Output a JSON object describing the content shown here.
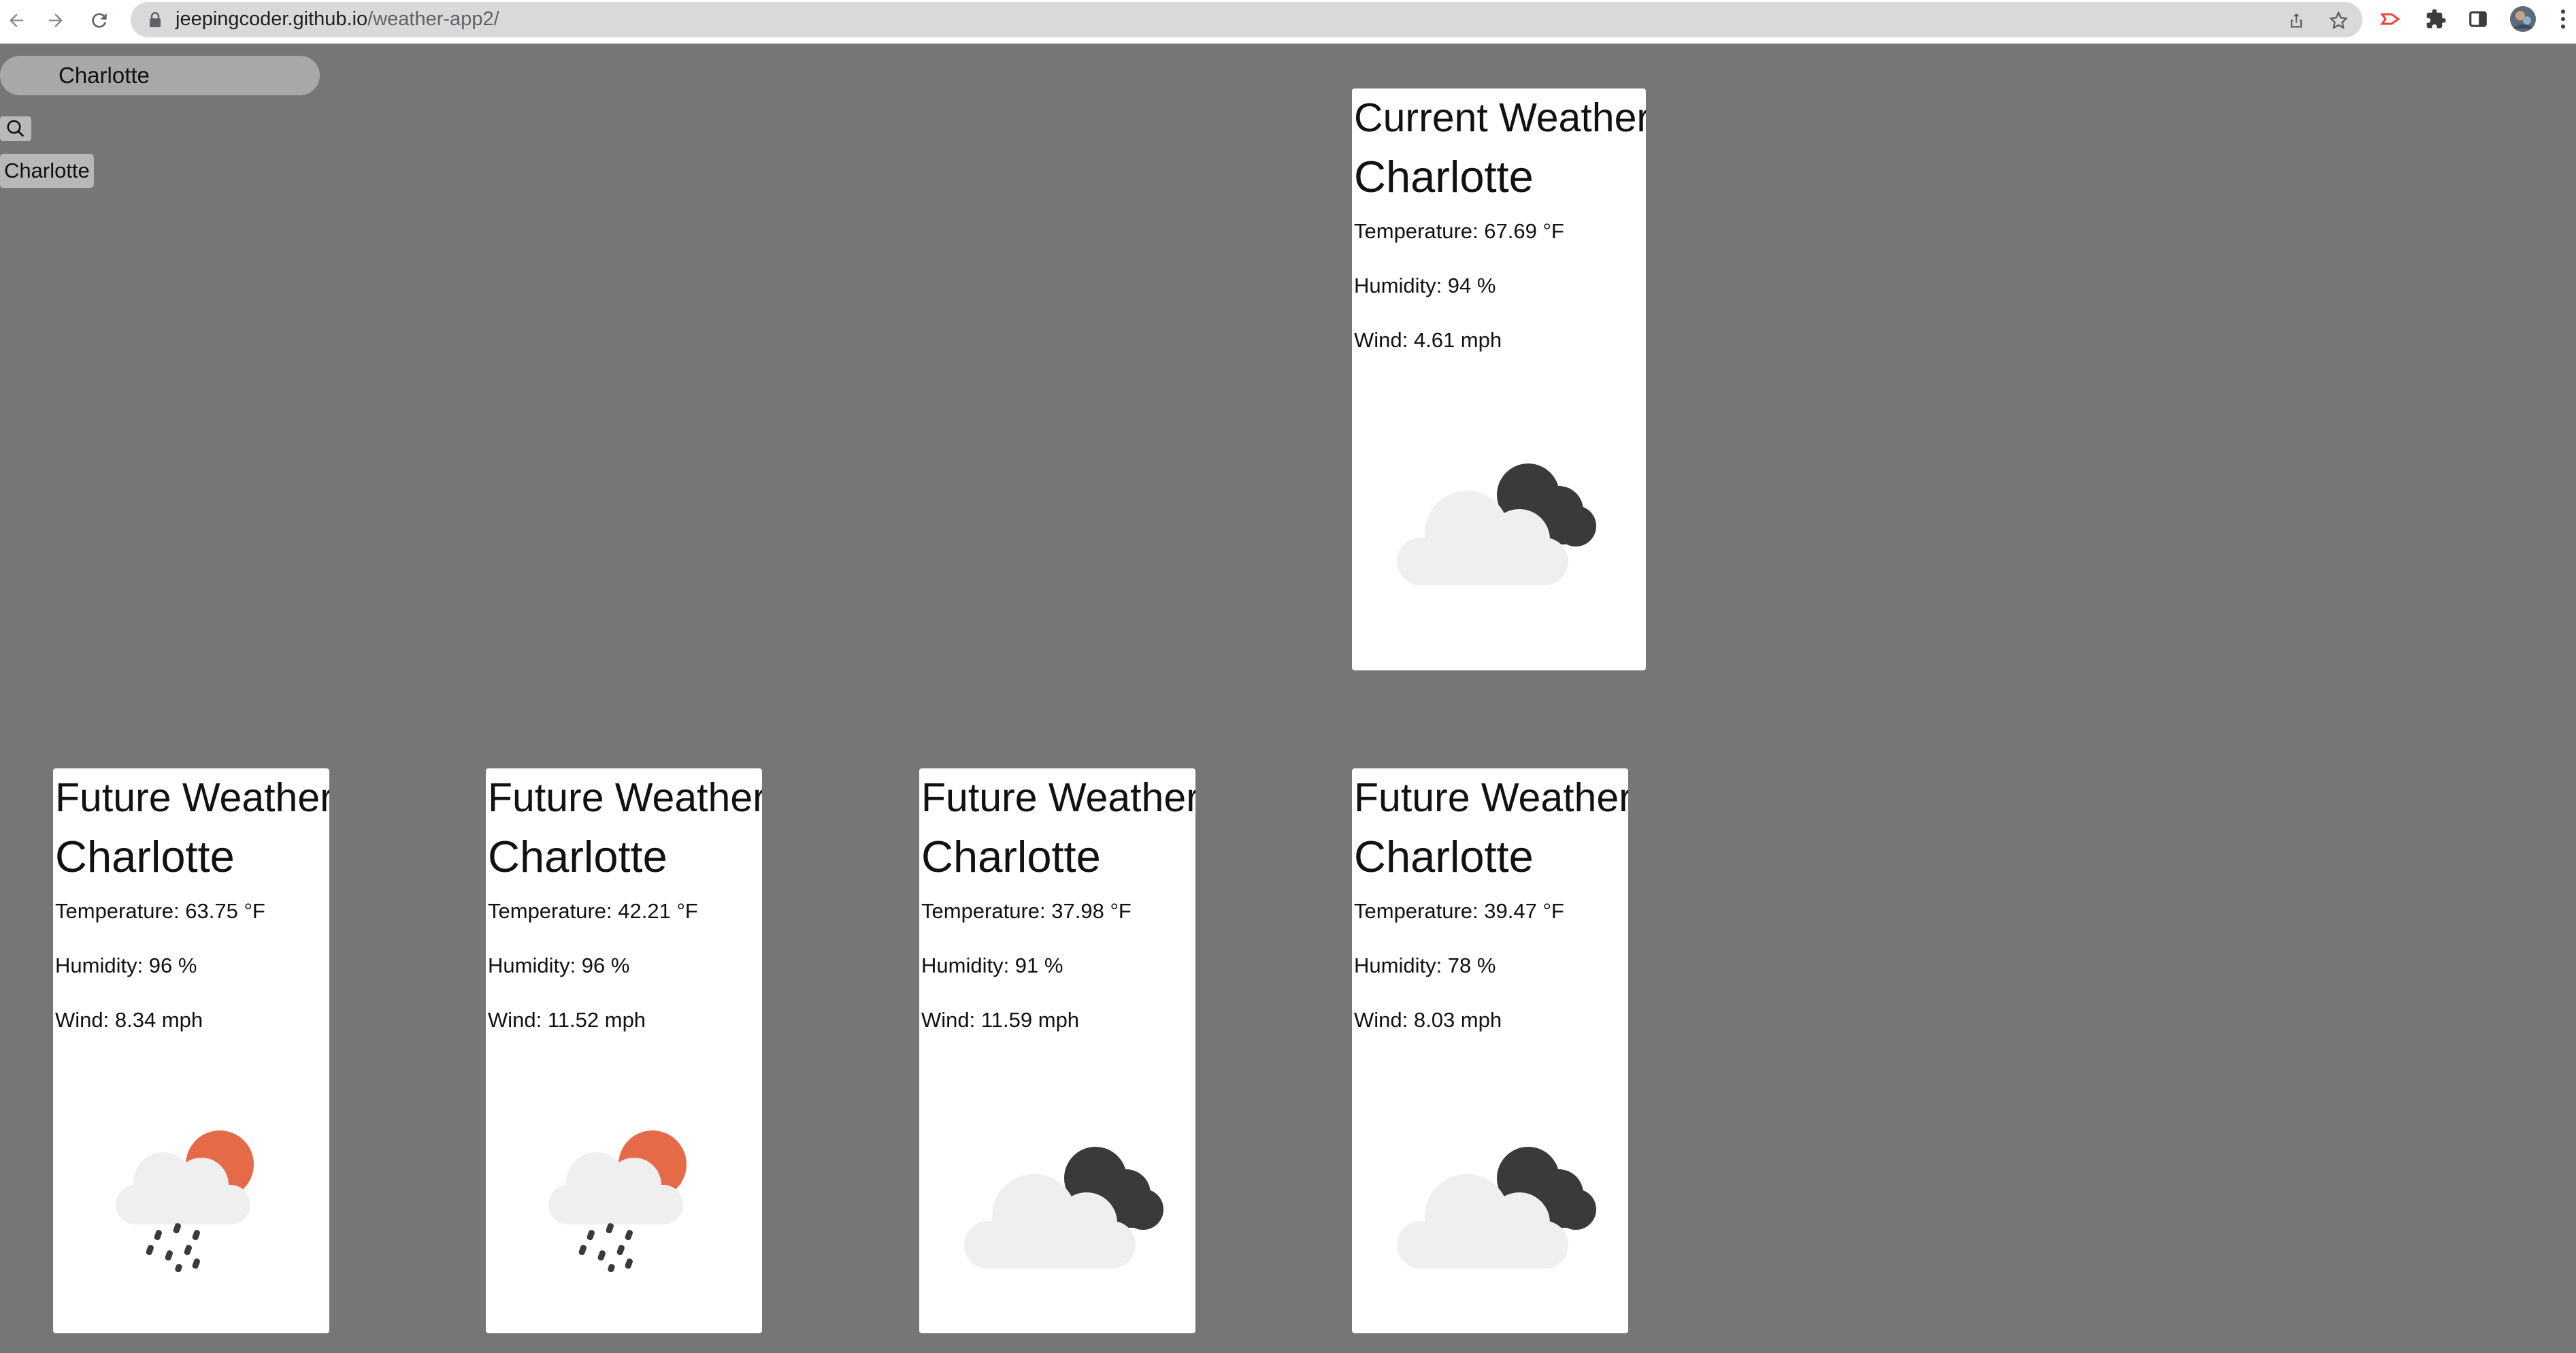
{
  "browser": {
    "url_host": "jeepingcoder.github.io",
    "url_path": "/weather-app2/"
  },
  "search": {
    "value": "Charlotte"
  },
  "history": [
    "Charlotte"
  ],
  "current": {
    "heading": "Current Weather",
    "city": "Charlotte",
    "temperature": "Temperature: 67.69 °F",
    "humidity": "Humidity: 94 %",
    "wind": "Wind: 4.61 mph",
    "icon": "dark-cloud-icon"
  },
  "forecast": [
    {
      "heading": "Future Weather",
      "city": "Charlotte",
      "temperature": "Temperature: 63.75 °F",
      "humidity": "Humidity: 96 %",
      "wind": "Wind: 8.34 mph",
      "icon": "sun-rain-cloud-icon"
    },
    {
      "heading": "Future Weather",
      "city": "Charlotte",
      "temperature": "Temperature: 42.21 °F",
      "humidity": "Humidity: 96 %",
      "wind": "Wind: 11.52 mph",
      "icon": "sun-rain-cloud-icon"
    },
    {
      "heading": "Future Weather",
      "city": "Charlotte",
      "temperature": "Temperature: 37.98 °F",
      "humidity": "Humidity: 91 %",
      "wind": "Wind: 11.59 mph",
      "icon": "dark-cloud-icon"
    },
    {
      "heading": "Future Weather",
      "city": "Charlotte",
      "temperature": "Temperature: 39.47 °F",
      "humidity": "Humidity: 78 %",
      "wind": "Wind: 8.03 mph",
      "icon": "dark-cloud-icon"
    }
  ],
  "colors": {
    "page_background": "#767676",
    "card_background": "#ffffff",
    "sun": "#e56a48",
    "dark_cloud": "#3a3a3a",
    "light_cloud": "#efefef"
  }
}
